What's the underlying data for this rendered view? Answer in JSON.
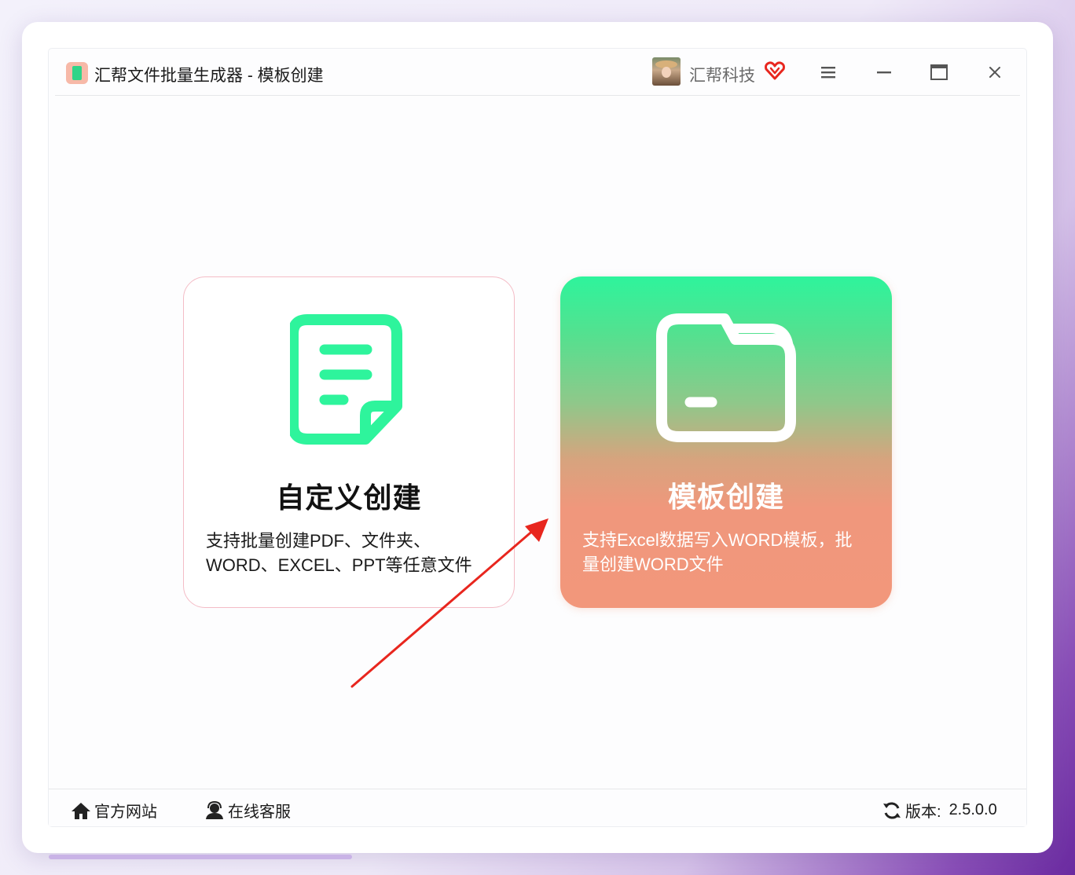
{
  "window": {
    "title": "汇帮文件批量生成器 - 模板创建",
    "company": "汇帮科技",
    "icons": {
      "app": "app-logo-icon",
      "vip": "vip-heart-icon",
      "menu": "menu-icon",
      "minimize": "minimize-icon",
      "maximize": "maximize-icon",
      "close": "close-icon"
    }
  },
  "cards": {
    "custom": {
      "icon": "document-icon",
      "title": "自定义创建",
      "desc_line1": "支持批量创建PDF、文件夹、",
      "desc_line2": "WORD、EXCEL、PPT等任意文件"
    },
    "template": {
      "icon": "folder-icon",
      "title": "模板创建",
      "desc_line1": "支持Excel数据写入WORD模板，批",
      "desc_line2": "量创建WORD文件"
    }
  },
  "footer": {
    "website": "官方网站",
    "support": "在线客服",
    "version_label": "版本:",
    "version_value": "2.5.0.0"
  },
  "colors": {
    "green_accent": "#2ef49c",
    "salmon_accent": "#f2977b",
    "pink_border": "#f4bcc6",
    "arrow_red": "#e8261e"
  }
}
